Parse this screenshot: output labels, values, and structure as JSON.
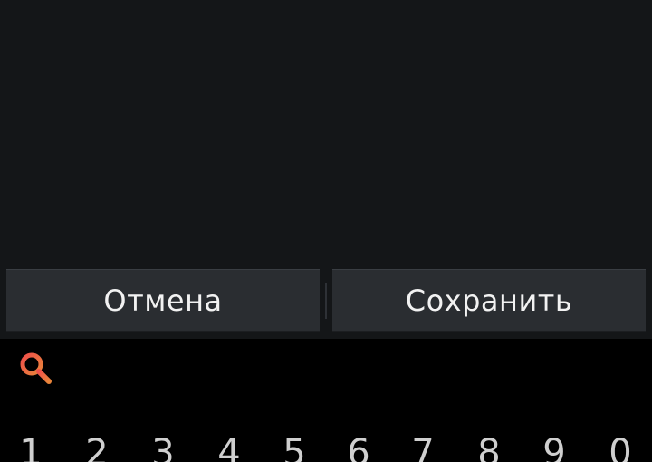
{
  "dialog": {
    "cancel_label": "Отмена",
    "save_label": "Сохранить"
  },
  "keyboard": {
    "search_icon": "search-icon",
    "search_icon_color": "#e8643c",
    "number_keys": [
      "1",
      "2",
      "3",
      "4",
      "5",
      "6",
      "7",
      "8",
      "9",
      "0"
    ]
  },
  "colors": {
    "content_background": "#141618",
    "button_background": "#2a2d31",
    "keyboard_background": "#000000",
    "button_text": "#f2f2f2"
  }
}
